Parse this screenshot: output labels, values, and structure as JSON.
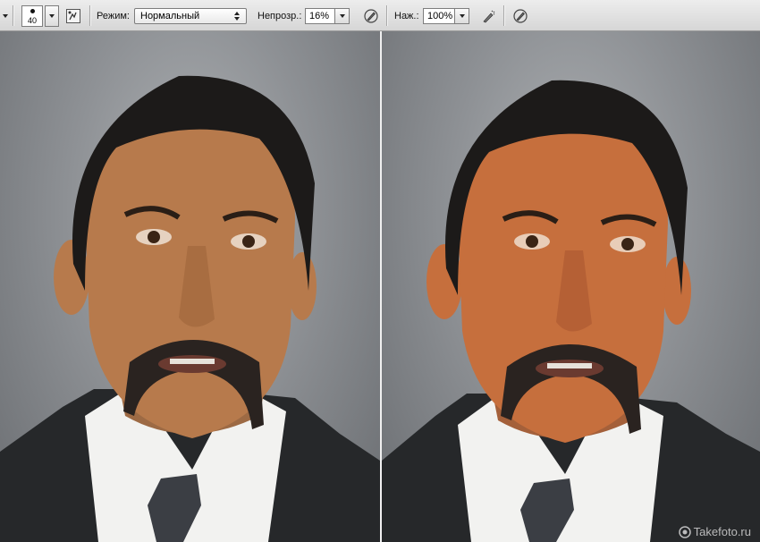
{
  "toolbar": {
    "brush_size": "40",
    "mode_label": "Режим:",
    "mode_value": "Нормальный",
    "opacity_label": "Непрозр.:",
    "opacity_value": "16%",
    "flow_label": "Наж.:",
    "flow_value": "100%"
  },
  "photos": {
    "left_skin": "#b77a4c",
    "right_skin": "#c66f3d"
  },
  "watermark": {
    "text": "Takefoto.ru"
  }
}
